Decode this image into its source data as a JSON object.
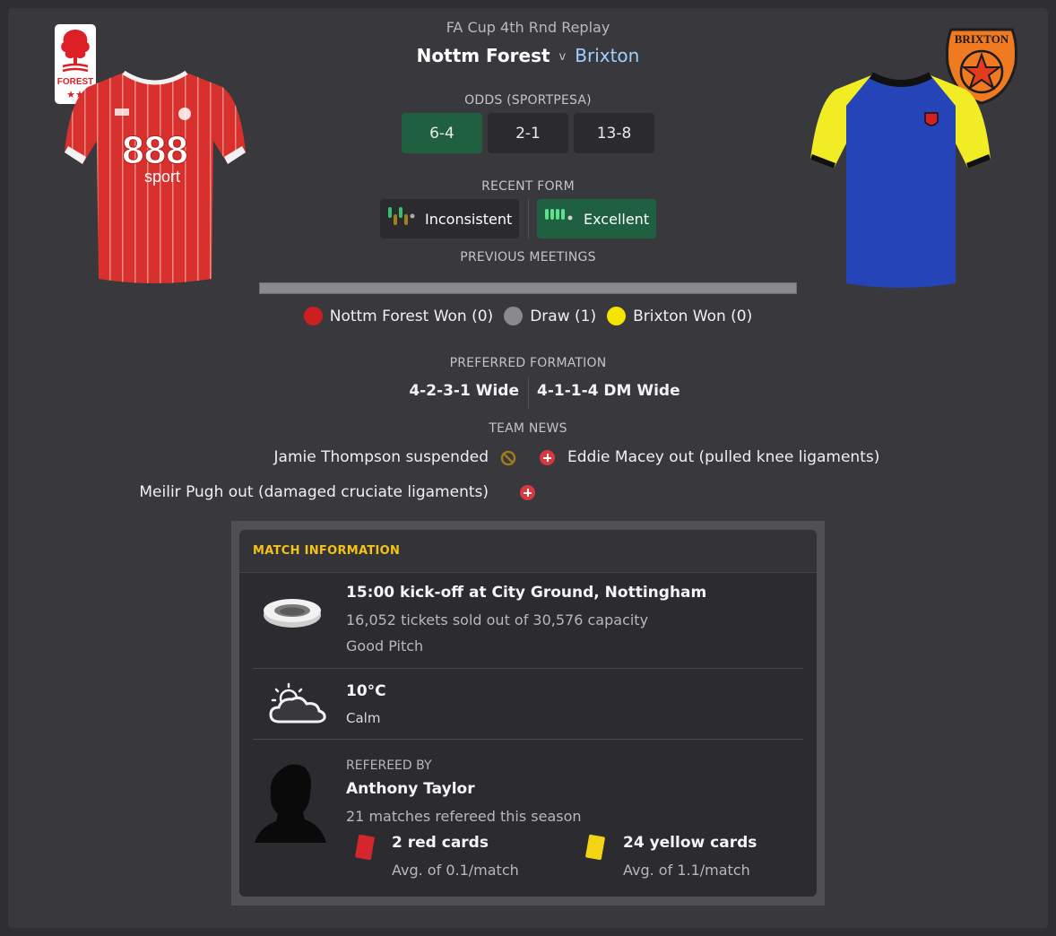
{
  "header": {
    "competition": "FA Cup 4th Rnd Replay",
    "home_team": "Nottm Forest",
    "vs": "v",
    "away_team": "Brixton",
    "home_badge_text": "FOREST",
    "away_badge_text": "BRIXTON"
  },
  "odds": {
    "label": "ODDS (SPORTPESA)",
    "home": "6-4",
    "draw": "2-1",
    "away": "13-8"
  },
  "form": {
    "label": "RECENT FORM",
    "home": "Inconsistent",
    "away": "Excellent"
  },
  "meetings": {
    "label": "PREVIOUS MEETINGS",
    "home_won": "Nottm Forest Won (0)",
    "draw": "Draw (1)",
    "away_won": "Brixton Won (0)"
  },
  "formation": {
    "label": "PREFERRED FORMATION",
    "home": "4-2-3-1 Wide",
    "away": "4-1-1-4 DM Wide"
  },
  "team_news": {
    "label": "TEAM NEWS",
    "home": [
      "Jamie Thompson suspended",
      "Meilir Pugh out (damaged cruciate ligaments)"
    ],
    "away": [
      "Eddie Macey out (pulled knee ligaments)"
    ]
  },
  "match_info": {
    "title": "MATCH INFORMATION",
    "venue": "15:00 kick-off at City Ground, Nottingham",
    "tickets": "16,052 tickets sold out of 30,576 capacity",
    "pitch": "Good Pitch",
    "temperature": "10°C",
    "wind": "Calm",
    "referee_label": "REFEREED BY",
    "referee": "Anthony Taylor",
    "matches": "21 matches refereed this season",
    "red_cards": "2 red cards",
    "red_avg": "Avg. of 0.1/match",
    "yellow_cards": "24 yellow cards",
    "yellow_avg": "Avg. of 1.1/match"
  },
  "colors": {
    "fav_odds": "#1f6040",
    "excellent": "#1f6040",
    "home_red": "#cc1f1f",
    "away_yellow": "#f5e400",
    "accent_yellow": "#f3c318"
  }
}
